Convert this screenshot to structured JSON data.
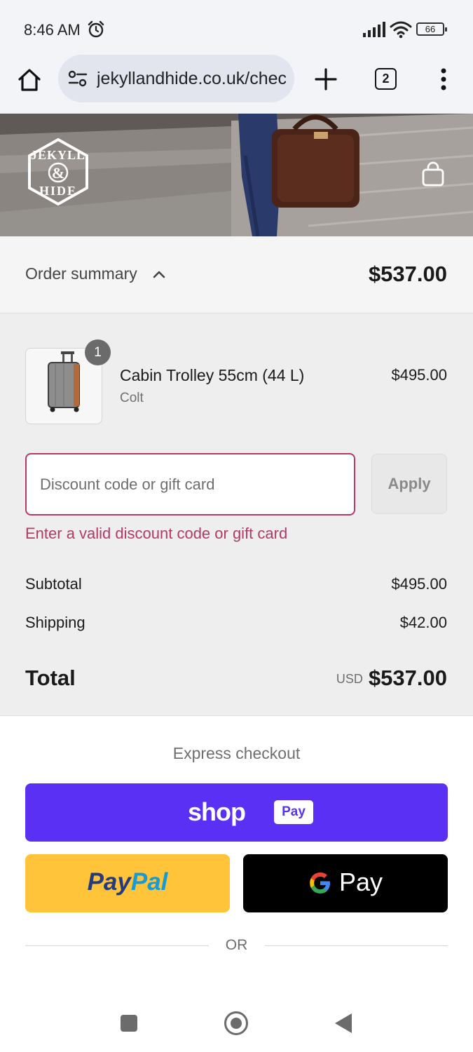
{
  "status_bar": {
    "time": "8:46 AM",
    "battery": "66"
  },
  "browser": {
    "url": "jekyllandhide.co.uk/checkouts",
    "tab_count": "2"
  },
  "brand": {
    "logo_text_top": "JEKYLL",
    "logo_text_center": "&",
    "logo_text_bottom": "HIDE"
  },
  "order_summary": {
    "toggle_label": "Order summary",
    "total": "$537.00"
  },
  "line_items": [
    {
      "quantity": "1",
      "name": "Cabin Trolley 55cm (44 L)",
      "variant": "Colt",
      "price": "$495.00"
    }
  ],
  "discount": {
    "placeholder": "Discount code or gift card",
    "value": "",
    "apply_label": "Apply",
    "error": "Enter a valid discount code or gift card"
  },
  "totals": {
    "subtotal_label": "Subtotal",
    "subtotal_value": "$495.00",
    "shipping_label": "Shipping",
    "shipping_value": "$42.00",
    "total_label": "Total",
    "currency": "USD",
    "total_value": "$537.00"
  },
  "express_checkout": {
    "title": "Express checkout",
    "shoppay_word": "shop",
    "shoppay_chip": "Pay",
    "paypal_part1": "Pay",
    "paypal_part2": "Pal",
    "gpay_word": "Pay",
    "or_text": "OR"
  },
  "colors": {
    "shop_pay": "#5a31f4",
    "paypal": "#ffc439",
    "gpay": "#000000",
    "error": "#b33a63"
  },
  "icons": [
    "alarm-icon",
    "signal-icon",
    "wifi-icon",
    "home-icon",
    "site-settings-icon",
    "plus-icon",
    "menu-icon",
    "bag-icon",
    "chevron-up-icon",
    "google-g-icon"
  ]
}
